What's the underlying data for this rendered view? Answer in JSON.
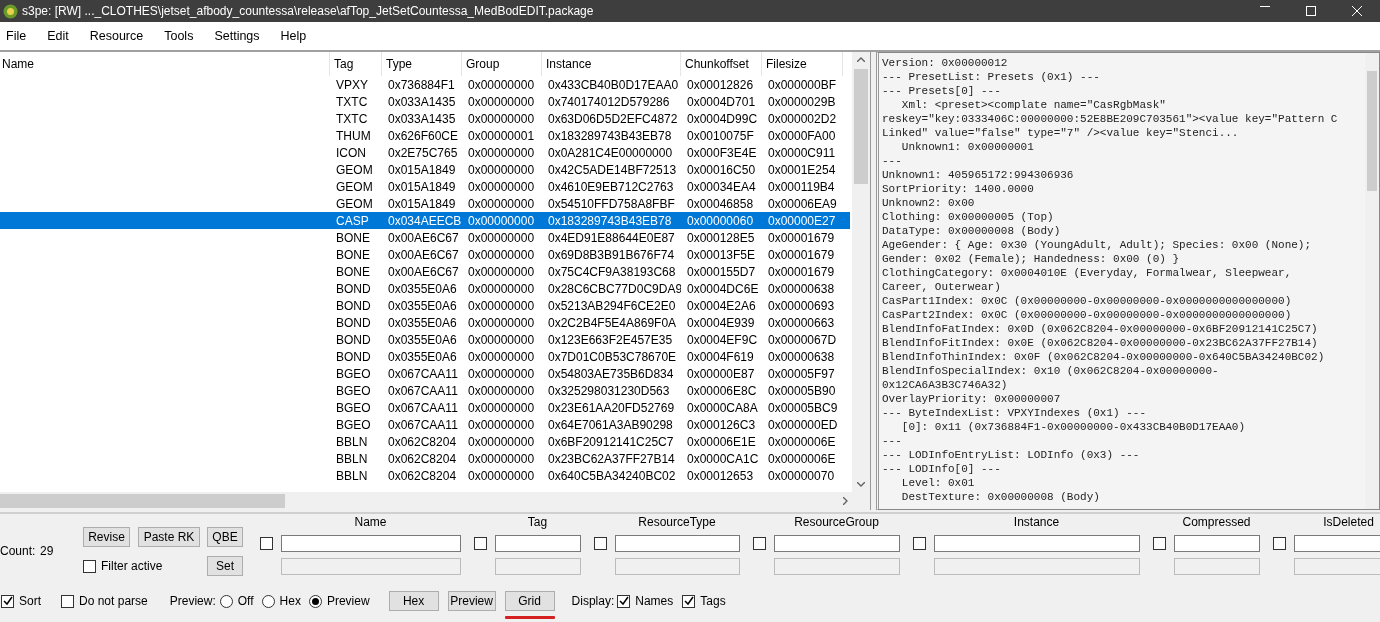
{
  "window": {
    "title": "s3pe: [RW] ..._CLOTHES\\jetset_afbody_countessa\\release\\afTop_JetSetCountessa_MedBodEDIT.package"
  },
  "menu": [
    "File",
    "Edit",
    "Resource",
    "Tools",
    "Settings",
    "Help"
  ],
  "table": {
    "columns": [
      "Name",
      "Tag",
      "Type",
      "Group",
      "Instance",
      "Chunkoffset",
      "Filesize"
    ],
    "rows": [
      {
        "selected": false,
        "cells": [
          "",
          "VPXY",
          "0x736884F1",
          "0x00000000",
          "0x433CB40B0D17EAA0",
          "0x00012826",
          "0x000000BF"
        ]
      },
      {
        "selected": false,
        "cells": [
          "",
          "TXTC",
          "0x033A1435",
          "0x00000000",
          "0x740174012D579286",
          "0x0004D701",
          "0x0000029B"
        ]
      },
      {
        "selected": false,
        "cells": [
          "",
          "TXTC",
          "0x033A1435",
          "0x00000000",
          "0x63D06D5D2EFC4872",
          "0x0004D99C",
          "0x000002D2"
        ]
      },
      {
        "selected": false,
        "cells": [
          "",
          "THUM",
          "0x626F60CE",
          "0x00000001",
          "0x183289743B43EB78",
          "0x0010075F",
          "0x0000FA00"
        ]
      },
      {
        "selected": false,
        "cells": [
          "",
          "ICON",
          "0x2E75C765",
          "0x00000000",
          "0x0A281C4E00000000",
          "0x000F3E4E",
          "0x0000C911"
        ]
      },
      {
        "selected": false,
        "cells": [
          "",
          "GEOM",
          "0x015A1849",
          "0x00000000",
          "0x42C5ADE14BF72513",
          "0x00016C50",
          "0x0001E254"
        ]
      },
      {
        "selected": false,
        "cells": [
          "",
          "GEOM",
          "0x015A1849",
          "0x00000000",
          "0x4610E9EB712C2763",
          "0x00034EA4",
          "0x000119B4"
        ]
      },
      {
        "selected": false,
        "cells": [
          "",
          "GEOM",
          "0x015A1849",
          "0x00000000",
          "0x54510FFD758A8FBF",
          "0x00046858",
          "0x00006EA9"
        ]
      },
      {
        "selected": true,
        "cells": [
          "",
          "CASP",
          "0x034AEECB",
          "0x00000000",
          "0x183289743B43EB78",
          "0x00000060",
          "0x00000E27"
        ]
      },
      {
        "selected": false,
        "cells": [
          "",
          "BONE",
          "0x00AE6C67",
          "0x00000000",
          "0x4ED91E88644E0E87",
          "0x000128E5",
          "0x00001679"
        ]
      },
      {
        "selected": false,
        "cells": [
          "",
          "BONE",
          "0x00AE6C67",
          "0x00000000",
          "0x69D8B3B91B676F74",
          "0x00013F5E",
          "0x00001679"
        ]
      },
      {
        "selected": false,
        "cells": [
          "",
          "BONE",
          "0x00AE6C67",
          "0x00000000",
          "0x75C4CF9A38193C68",
          "0x000155D7",
          "0x00001679"
        ]
      },
      {
        "selected": false,
        "cells": [
          "",
          "BOND",
          "0x0355E0A6",
          "0x00000000",
          "0x28C6CBC77D0C9DA9",
          "0x0004DC6E",
          "0x00000638"
        ]
      },
      {
        "selected": false,
        "cells": [
          "",
          "BOND",
          "0x0355E0A6",
          "0x00000000",
          "0x5213AB294F6CE2E0",
          "0x0004E2A6",
          "0x00000693"
        ]
      },
      {
        "selected": false,
        "cells": [
          "",
          "BOND",
          "0x0355E0A6",
          "0x00000000",
          "0x2C2B4F5E4A869F0A",
          "0x0004E939",
          "0x00000663"
        ]
      },
      {
        "selected": false,
        "cells": [
          "",
          "BOND",
          "0x0355E0A6",
          "0x00000000",
          "0x123E663F2E457E35",
          "0x0004EF9C",
          "0x0000067D"
        ]
      },
      {
        "selected": false,
        "cells": [
          "",
          "BOND",
          "0x0355E0A6",
          "0x00000000",
          "0x7D01C0B53C78670E",
          "0x0004F619",
          "0x00000638"
        ]
      },
      {
        "selected": false,
        "cells": [
          "",
          "BGEO",
          "0x067CAA11",
          "0x00000000",
          "0x54803AE735B6D834",
          "0x00000E87",
          "0x00005F97"
        ]
      },
      {
        "selected": false,
        "cells": [
          "",
          "BGEO",
          "0x067CAA11",
          "0x00000000",
          "0x325298031230D563",
          "0x00006E8C",
          "0x00005B90"
        ]
      },
      {
        "selected": false,
        "cells": [
          "",
          "BGEO",
          "0x067CAA11",
          "0x00000000",
          "0x23E61AA20FD52769",
          "0x0000CA8A",
          "0x00005BC9"
        ]
      },
      {
        "selected": false,
        "cells": [
          "",
          "BGEO",
          "0x067CAA11",
          "0x00000000",
          "0x64E7061A3AB90298",
          "0x000126C3",
          "0x000000ED"
        ]
      },
      {
        "selected": false,
        "cells": [
          "",
          "BBLN",
          "0x062C8204",
          "0x00000000",
          "0x6BF20912141C25C7",
          "0x00006E1E",
          "0x0000006E"
        ]
      },
      {
        "selected": false,
        "cells": [
          "",
          "BBLN",
          "0x062C8204",
          "0x00000000",
          "0x23BC62A37FF27B14",
          "0x0000CA1C",
          "0x0000006E"
        ]
      },
      {
        "selected": false,
        "cells": [
          "",
          "BBLN",
          "0x062C8204",
          "0x00000000",
          "0x640C5BA34240BC02",
          "0x00012653",
          "0x00000070"
        ]
      }
    ]
  },
  "preview": [
    "Version: 0x00000012",
    "--- PresetList: Presets (0x1) ---",
    "--- Presets[0] ---",
    "   Xml: <preset><complate name=\"CasRgbMask\"",
    "reskey=\"key:0333406C:00000000:52E8BE209C703561\"><value key=\"Pattern C",
    "Linked\" value=\"false\" type=\"7\" /><value key=\"Stenci...",
    "   Unknown1: 0x00000001",
    "---",
    "Unknown1: 405965172:994306936",
    "SortPriority: 1400.0000",
    "Unknown2: 0x00",
    "Clothing: 0x00000005 (Top)",
    "DataType: 0x00000008 (Body)",
    "AgeGender: { Age: 0x30 (YoungAdult, Adult); Species: 0x00 (None);",
    "Gender: 0x02 (Female); Handedness: 0x00 (0) }",
    "ClothingCategory: 0x0004010E (Everyday, Formalwear, Sleepwear,",
    "Career, Outerwear)",
    "CasPart1Index: 0x0C (0x00000000-0x00000000-0x0000000000000000)",
    "CasPart2Index: 0x0C (0x00000000-0x00000000-0x0000000000000000)",
    "BlendInfoFatIndex: 0x0D (0x062C8204-0x00000000-0x6BF20912141C25C7)",
    "BlendInfoFitIndex: 0x0E (0x062C8204-0x00000000-0x23BC62A37FF27B14)",
    "BlendInfoThinIndex: 0x0F (0x062C8204-0x00000000-0x640C5BA34240BC02)",
    "BlendInfoSpecialIndex: 0x10 (0x062C8204-0x00000000-",
    "0x12CA6A3B3C746A32)",
    "OverlayPriority: 0x00000007",
    "--- ByteIndexList: VPXYIndexes (0x1) ---",
    "   [0]: 0x11 (0x736884F1-0x00000000-0x433CB40B0D17EAA0)",
    "---",
    "--- LODInfoEntryList: LODInfo (0x3) ---",
    "--- LODInfo[0] ---",
    "   Level: 0x01",
    "   DestTexture: 0x00000008 (Body)"
  ],
  "controls": {
    "count_label": "Count:",
    "count": "29",
    "buttons": [
      "Revise",
      "Paste RK",
      "QBE"
    ],
    "set_button": "Set",
    "filter_active": {
      "label": "Filter active",
      "checked": false
    }
  },
  "filters": [
    {
      "label": "Name",
      "checked": false
    },
    {
      "label": "Tag",
      "checked": false
    },
    {
      "label": "ResourceType",
      "checked": false
    },
    {
      "label": "ResourceGroup",
      "checked": false
    },
    {
      "label": "Instance",
      "checked": false
    },
    {
      "label": "Compressed",
      "checked": false
    },
    {
      "label": "IsDeleted",
      "checked": false
    }
  ],
  "options": {
    "sort": {
      "label": "Sort",
      "checked": true
    },
    "do_not_parse": {
      "label": "Do not parse",
      "checked": false
    },
    "preview_label": "Preview:",
    "preview_modes": [
      {
        "label": "Off",
        "selected": false
      },
      {
        "label": "Hex",
        "selected": false
      },
      {
        "label": "Preview",
        "selected": true
      }
    ],
    "view_buttons": [
      {
        "label": "Hex",
        "underlined": false
      },
      {
        "label": "Preview",
        "underlined": false
      },
      {
        "label": "Grid",
        "underlined": true
      }
    ],
    "display_label": "Display:",
    "display": [
      {
        "label": "Names",
        "checked": true
      },
      {
        "label": "Tags",
        "checked": true
      }
    ]
  }
}
